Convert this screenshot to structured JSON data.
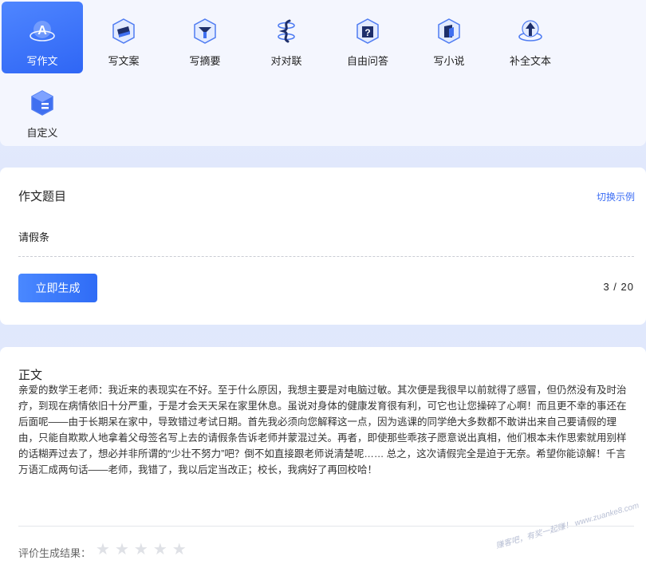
{
  "modes": [
    {
      "label": "写作文",
      "icon": "compose-essay-icon",
      "active": true
    },
    {
      "label": "写文案",
      "icon": "copywriting-icon",
      "active": false
    },
    {
      "label": "写摘要",
      "icon": "summary-icon",
      "active": false
    },
    {
      "label": "对对联",
      "icon": "couplet-icon",
      "active": false
    },
    {
      "label": "自由问答",
      "icon": "question-icon",
      "active": false
    },
    {
      "label": "写小说",
      "icon": "novel-icon",
      "active": false
    },
    {
      "label": "补全文本",
      "icon": "complete-text-icon",
      "active": false
    },
    {
      "label": "自定义",
      "icon": "custom-icon",
      "active": false
    }
  ],
  "topic": {
    "title": "作文题目",
    "switch_label": "切换示例",
    "value": "请假条",
    "generate_label": "立即生成",
    "counter": "3 / 20"
  },
  "body": {
    "title": "正文",
    "text": "亲爱的数学王老师：我近来的表现实在不好。至于什么原因，我想主要是对电脑过敏。其次便是我很早以前就得了感冒，但仍然没有及时治疗，到现在病情依旧十分严重，于是才会天天呆在家里休息。虽说对身体的健康发育很有利，可它也让您操碎了心啊！而且更不幸的事还在后面呢——由于长期呆在家中，导致错过考试日期。首先我必须向您解释这一点，因为逃课的同学绝大多数都不敢讲出来自己要请假的理由，只能自欺欺人地拿着父母签名写上去的请假条告诉老师并蒙混过关。再者，即使那些乖孩子愿意说出真相，他们根本未作思索就用别样的话糊弄过去了，想必并非所谓的“少壮不努力”吧？倒不如直接跟老师说清楚呢…… 总之，这次请假完全是迫于无奈。希望你能谅解！千言万语汇成两句话——老师，我错了，我以后定当改正；校长，我病好了再回校哈！",
    "rating_label": "评价生成结果：",
    "rating": 0,
    "rating_max": 5
  },
  "watermark": "赚客吧，有奖一起赚！ www.zuanke8.com",
  "colors": {
    "accent": "#2f6cf6",
    "link": "#3a6cf4",
    "star_empty": "#dfe1e6"
  }
}
